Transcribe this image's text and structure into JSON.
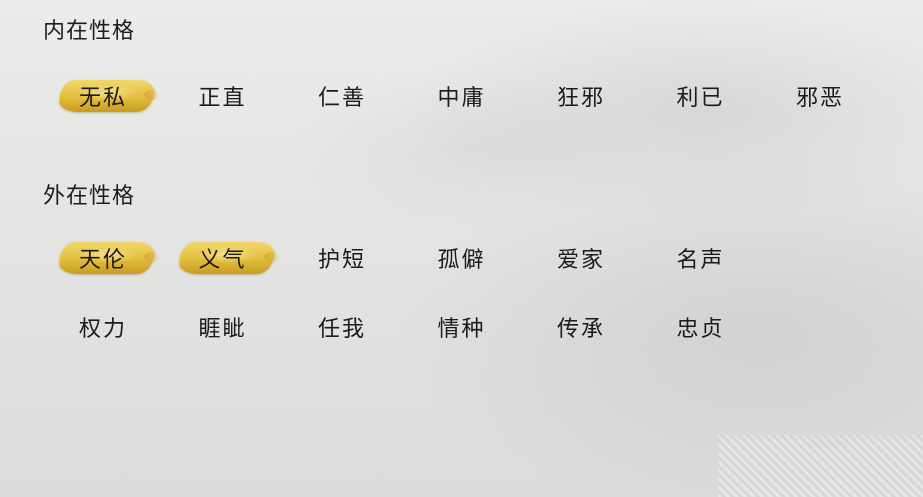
{
  "inner": {
    "title": "内在性格",
    "traits": [
      {
        "label": "无私",
        "selected": true
      },
      {
        "label": "正直",
        "selected": false
      },
      {
        "label": "仁善",
        "selected": false
      },
      {
        "label": "中庸",
        "selected": false
      },
      {
        "label": "狂邪",
        "selected": false
      },
      {
        "label": "利已",
        "selected": false
      },
      {
        "label": "邪恶",
        "selected": false
      }
    ]
  },
  "outer": {
    "title": "外在性格",
    "row1": [
      {
        "label": "天伦",
        "selected": true
      },
      {
        "label": "义气",
        "selected": true
      },
      {
        "label": "护短",
        "selected": false
      },
      {
        "label": "孤僻",
        "selected": false
      },
      {
        "label": "爱家",
        "selected": false
      },
      {
        "label": "名声",
        "selected": false
      }
    ],
    "row2": [
      {
        "label": "权力",
        "selected": false
      },
      {
        "label": "睚眦",
        "selected": false
      },
      {
        "label": "任我",
        "selected": false
      },
      {
        "label": "情种",
        "selected": false
      },
      {
        "label": "传承",
        "selected": false
      },
      {
        "label": "忠贞",
        "selected": false
      }
    ]
  }
}
